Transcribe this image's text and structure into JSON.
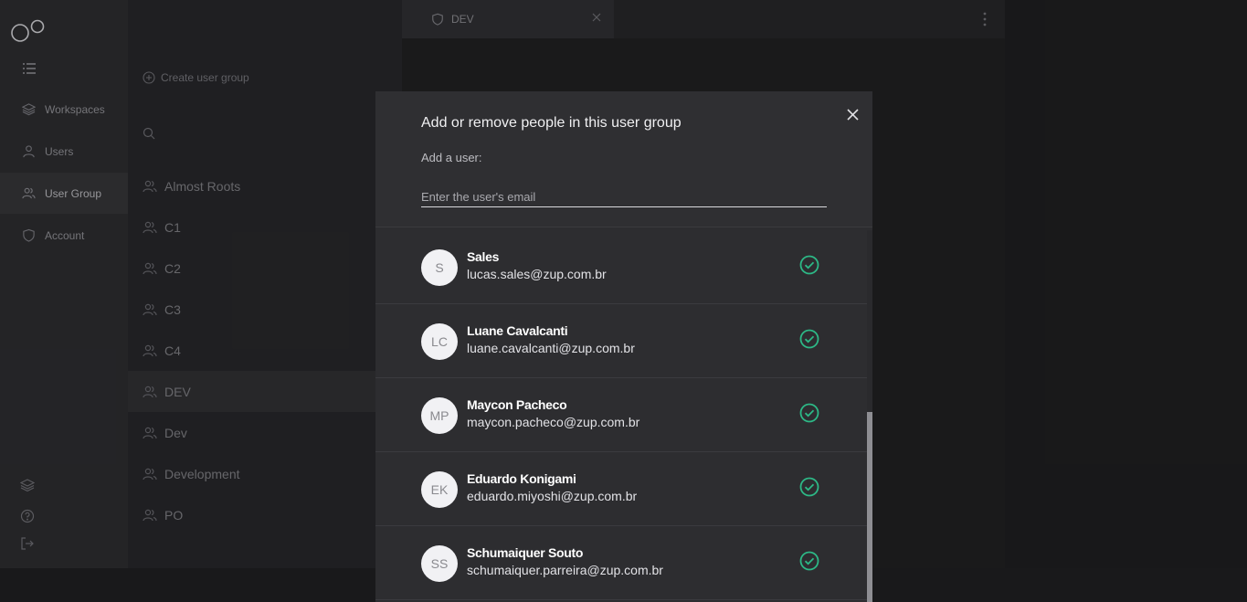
{
  "nav": {
    "items": [
      {
        "label": "Workspaces",
        "icon": "layers-icon"
      },
      {
        "label": "Users",
        "icon": "user-icon"
      },
      {
        "label": "User Group",
        "icon": "users-icon"
      },
      {
        "label": "Account",
        "icon": "shield-icon"
      }
    ]
  },
  "groups": {
    "create_label": "Create user group",
    "items": [
      "Almost Roots",
      "C1",
      "C2",
      "C3",
      "C4",
      "DEV",
      "Dev",
      "Development",
      "PO"
    ]
  },
  "tab": {
    "label": "DEV"
  },
  "modal": {
    "title": "Add or remove people in this user group",
    "add_label": "Add a user:",
    "email_placeholder": "Enter the user's email",
    "users": [
      {
        "initials": "S",
        "name": "Sales",
        "email": "lucas.sales@zup.com.br"
      },
      {
        "initials": "LC",
        "name": "Luane Cavalcanti",
        "email": "luane.cavalcanti@zup.com.br"
      },
      {
        "initials": "MP",
        "name": "Maycon Pacheco",
        "email": "maycon.pacheco@zup.com.br"
      },
      {
        "initials": "EK",
        "name": "Eduardo Konigami",
        "email": "eduardo.miyoshi@zup.com.br"
      },
      {
        "initials": "SS",
        "name": "Schumaiquer Souto",
        "email": "schumaiquer.parreira@zup.com.br"
      }
    ]
  },
  "colors": {
    "accent_check": "#2db886",
    "modal_bg": "#2d2d30"
  }
}
